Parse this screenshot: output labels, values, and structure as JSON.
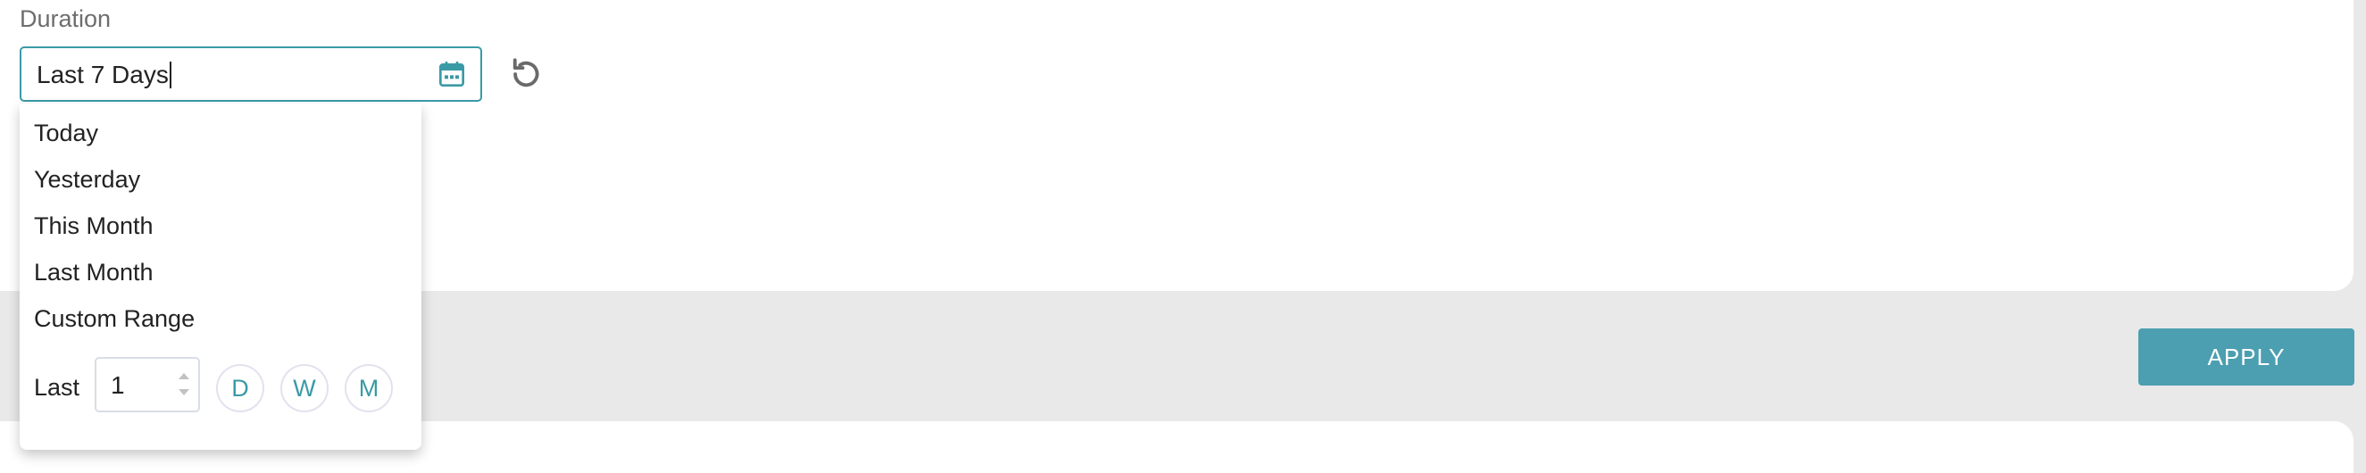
{
  "filter": {
    "label": "Duration",
    "value": "Last 7 Days"
  },
  "dropdown": {
    "options": [
      "Today",
      "Yesterday",
      "This Month",
      "Last Month",
      "Custom Range"
    ],
    "last_label": "Last",
    "last_value": "1",
    "units": [
      "D",
      "W",
      "M"
    ]
  },
  "actions": {
    "apply_label": "APPLY"
  },
  "icons": {
    "calendar": "calendar-icon",
    "reset": "reset-icon"
  },
  "colors": {
    "accent": "#3a9aa6",
    "apply_bg": "#4c9fb1",
    "page_bg": "#e9e9e9"
  }
}
